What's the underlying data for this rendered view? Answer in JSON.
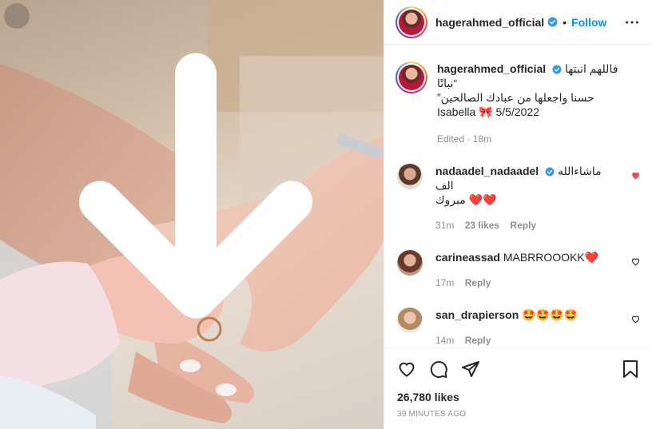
{
  "post": {
    "username": "hagerahmed_official",
    "follow_label": "Follow",
    "dot": "•",
    "caption_line1": "فاللهم انبتها نباتًا“",
    "caption_line2": "”حسنا واجعلها من عبادك الصالحين",
    "caption_line3_name": "Isabella",
    "caption_line3_emoji": "🎀",
    "caption_line3_date": "5/5/2022",
    "edited_label": "Edited",
    "edited_sep": "·",
    "edited_time": "18m",
    "likes_count": "26,780 likes",
    "timestamp": "39 MINUTES AGO"
  },
  "comments": [
    {
      "username": "nadaadel_nadaadel",
      "verified": true,
      "text_line1": "ماشاءالله الف",
      "text_line2": "مبروك ❤️❤️",
      "time": "31m",
      "likes": "23 likes",
      "reply": "Reply",
      "liked": true
    },
    {
      "username": "carineassad",
      "verified": false,
      "text_line1": "MABRROOOKK❤️",
      "time": "17m",
      "reply": "Reply",
      "liked": false
    },
    {
      "username": "san_drapierson",
      "verified": false,
      "text_line1": "🤩🤩🤩🤩",
      "time": "14m",
      "reply": "Reply",
      "liked": false
    }
  ],
  "icons": {
    "download": "download-icon",
    "verified": "verified-badge-icon",
    "more": "more-options-icon",
    "like": "heart-icon",
    "comment": "comment-icon",
    "share": "share-icon",
    "save": "bookmark-icon"
  },
  "colors": {
    "accent": "#0095f6",
    "liked_heart": "#ed4956",
    "muted_text": "#8e8e8e",
    "border": "#efefef"
  }
}
